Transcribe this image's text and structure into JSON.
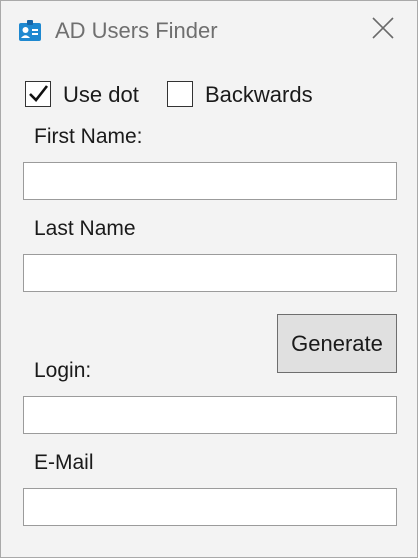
{
  "window": {
    "title": "AD Users Finder"
  },
  "options": {
    "use_dot": {
      "label": "Use dot",
      "checked": true
    },
    "backwards": {
      "label": "Backwards",
      "checked": false
    }
  },
  "fields": {
    "first_name": {
      "label": "First Name:",
      "value": ""
    },
    "last_name": {
      "label": "Last Name",
      "value": ""
    },
    "login": {
      "label": "Login:",
      "value": ""
    },
    "email": {
      "label": "E-Mail",
      "value": ""
    }
  },
  "actions": {
    "generate_label": "Generate"
  },
  "icons": {
    "app": "contact-card-icon",
    "close": "close-icon",
    "check": "checkmark-icon"
  },
  "colors": {
    "app_icon": "#1e88d0",
    "window_bg": "#f3f3f3",
    "button_bg": "#e0e0e0"
  }
}
